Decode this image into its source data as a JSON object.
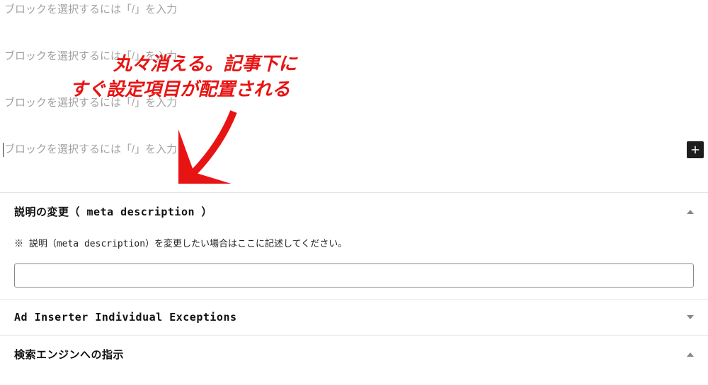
{
  "editor": {
    "placeholders": [
      "ブロックを選択するには「/」を入力",
      "ブロックを選択するには「/」を入力",
      "ブロックを選択するには「/」を入力",
      "ブロックを選択するには「/」を入力"
    ],
    "add_button": "+"
  },
  "annotation": {
    "line1": "丸々消える。記事下に",
    "line2": "すぐ設定項目が配置される"
  },
  "panels": {
    "meta": {
      "title": "説明の変更（ meta description ）",
      "help": "※ 説明（meta description）を変更したい場合はここに記述してください。",
      "value": ""
    },
    "ad": {
      "title": "Ad Inserter Individual Exceptions"
    },
    "seo": {
      "title": "検索エンジンへの指示"
    }
  }
}
